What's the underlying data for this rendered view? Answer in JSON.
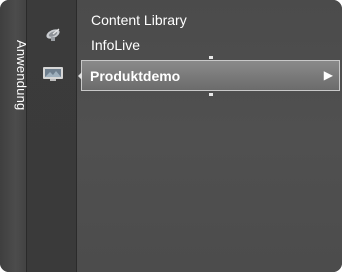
{
  "category": {
    "label": "Anwendung"
  },
  "icons": [
    "satellite-dish-icon",
    "monitor-icon"
  ],
  "menu": {
    "items": [
      {
        "label": "Content Library"
      },
      {
        "label": "InfoLive"
      }
    ],
    "selected": {
      "label": "Produktdemo",
      "arrow": "▶"
    }
  },
  "colors": {
    "background": "#4a4a4a",
    "highlight": "#7a7a7a",
    "text": "#ffffff"
  }
}
